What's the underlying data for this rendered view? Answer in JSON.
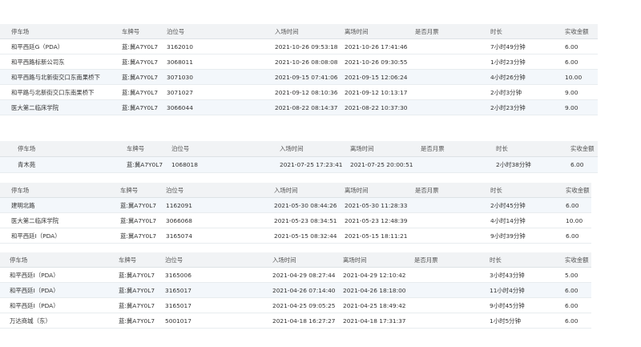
{
  "colors": {
    "header_bg": "#f1f3f5",
    "row_alt_bg": "#f3f7fb",
    "row_bg": "#ffffff",
    "border": "#e8ecef",
    "text": "#333333"
  },
  "tables": [
    {
      "columns": [
        "停车场",
        "车牌号",
        "泊位号",
        "入场时间",
        "离场时间",
        "是否月票",
        "时长",
        "实收金额"
      ],
      "rows": [
        [
          "和平西廷G（PDA）",
          "蓝:冀A7Y0L7",
          "3162010",
          "2021-10-26 09:53:18",
          "2021-10-26 17:41:46",
          "",
          "7小时49分钟",
          "6.00"
        ],
        [
          "和平西路标新公司东",
          "蓝:冀A7Y0L7",
          "3068011",
          "2021-10-26 08:08:08",
          "2021-10-26 09:30:55",
          "",
          "1小时23分钟",
          "6.00"
        ],
        [
          "和平西路与北新街交口东南果桥下",
          "蓝:冀A7Y0L7",
          "3071030",
          "2021-09-15 07:41:06",
          "2021-09-15 12:06:24",
          "",
          "4小时26分钟",
          "10.00"
        ],
        [
          "和平路与北新街交口东南果桥下",
          "蓝:冀A7Y0L7",
          "3071027",
          "2021-09-12 08:10:36",
          "2021-09-12 10:13:17",
          "",
          "2小时3分钟",
          "9.00"
        ],
        [
          "医大第二临床学院",
          "蓝:冀A7Y0L7",
          "3066044",
          "2021-08-22 08:14:37",
          "2021-08-22 10:37:30",
          "",
          "2小时23分钟",
          "9.00"
        ]
      ]
    },
    {
      "columns": [
        "停车场",
        "车牌号",
        "泊位号",
        "入场时间",
        "离场时间",
        "是否月票",
        "时长",
        "实收金额"
      ],
      "rows": [
        [
          "青木苑",
          "蓝:冀A7Y0L7",
          "1068018",
          "2021-07-25 17:23:41",
          "2021-07-25 20:00:51",
          "",
          "2小时38分钟",
          "6.00"
        ]
      ]
    },
    {
      "columns": [
        "停车场",
        "车牌号",
        "泊位号",
        "入场时间",
        "离场时间",
        "是否月票",
        "时长",
        "实收金额"
      ],
      "rows": [
        [
          "建明北路",
          "蓝:冀A7Y0L7",
          "1162091",
          "2021-05-30 08:44:26",
          "2021-05-30 11:28:33",
          "",
          "2小时45分钟",
          "6.00"
        ],
        [
          "医大第二临床学院",
          "蓝:冀A7Y0L7",
          "3066068",
          "2021-05-23 08:34:51",
          "2021-05-23 12:48:39",
          "",
          "4小时14分钟",
          "10.00"
        ],
        [
          "和平西廷I（PDA）",
          "蓝:冀A7Y0L7",
          "3165074",
          "2021-05-15 08:32:44",
          "2021-05-15 18:11:21",
          "",
          "9小时39分钟",
          "6.00"
        ]
      ]
    },
    {
      "columns": [
        "停车场",
        "车牌号",
        "泊位号",
        "入场时间",
        "离场时间",
        "是否月票",
        "时长",
        "实收金额"
      ],
      "rows": [
        [
          "和平西廷I（PDA）",
          "蓝:冀A7Y0L7",
          "3165006",
          "2021-04-29 08:27:44",
          "2021-04-29 12:10:42",
          "",
          "3小时43分钟",
          "5.00"
        ],
        [
          "和平西廷I（PDA）",
          "蓝:冀A7Y0L7",
          "3165017",
          "2021-04-26 07:14:40",
          "2021-04-26 18:18:00",
          "",
          "11小时4分钟",
          "6.00"
        ],
        [
          "和平西廷I（PDA）",
          "蓝:冀A7Y0L7",
          "3165017",
          "2021-04-25 09:05:25",
          "2021-04-25 18:49:42",
          "",
          "9小时45分钟",
          "6.00"
        ],
        [
          "万达商城（东）",
          "蓝:冀A7Y0L7",
          "5001017",
          "2021-04-18 16:27:27",
          "2021-04-18 17:31:37",
          "",
          "1小时5分钟",
          "6.00"
        ]
      ]
    }
  ]
}
